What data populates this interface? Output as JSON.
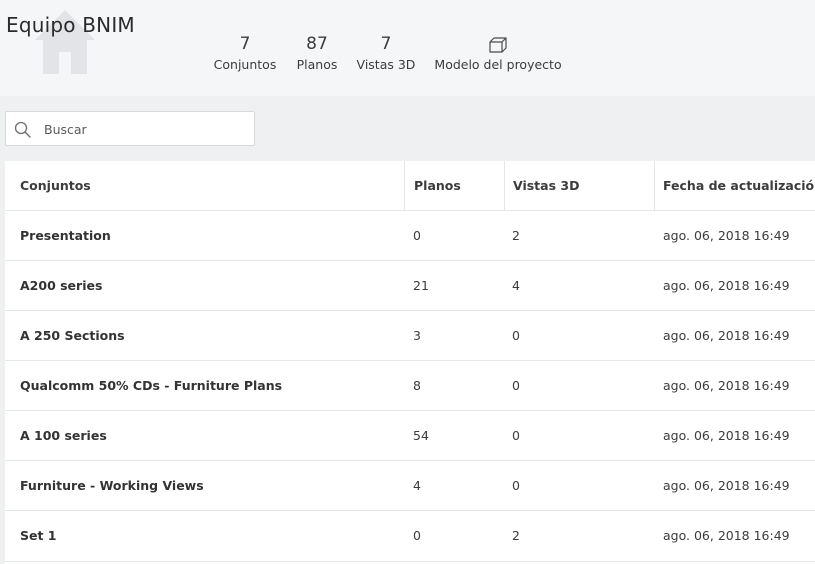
{
  "project": {
    "title": "Equipo BNIM"
  },
  "stats": {
    "sets": {
      "value": "7",
      "label": "Conjuntos"
    },
    "sheets": {
      "value": "87",
      "label": "Planos"
    },
    "views": {
      "value": "7",
      "label": "Vistas 3D"
    },
    "model": {
      "icon": "cube-icon",
      "label": "Modelo del proyecto"
    }
  },
  "search": {
    "placeholder": "Buscar",
    "value": ""
  },
  "table": {
    "headers": {
      "name": "Conjuntos",
      "sheets": "Planos",
      "views": "Vistas 3D",
      "date": "Fecha de actualización"
    },
    "rows": [
      {
        "name": "Presentation",
        "sheets": "0",
        "views": "2",
        "date": "ago. 06, 2018 16:49"
      },
      {
        "name": "A200 series",
        "sheets": "21",
        "views": "4",
        "date": "ago. 06, 2018 16:49"
      },
      {
        "name": "A 250 Sections",
        "sheets": "3",
        "views": "0",
        "date": "ago. 06, 2018 16:49"
      },
      {
        "name": "Qualcomm 50% CDs - Furniture Plans",
        "sheets": "8",
        "views": "0",
        "date": "ago. 06, 2018 16:49"
      },
      {
        "name": "A 100 series",
        "sheets": "54",
        "views": "0",
        "date": "ago. 06, 2018 16:49"
      },
      {
        "name": "Furniture - Working Views",
        "sheets": "4",
        "views": "0",
        "date": "ago. 06, 2018 16:49"
      },
      {
        "name": "Set 1",
        "sheets": "0",
        "views": "2",
        "date": "ago. 06, 2018 16:49"
      }
    ]
  },
  "colors": {
    "header_bg": "#f5f6f8",
    "page_bg": "#eef0f2",
    "house_icon": "#e2e4e7",
    "divider": "#e4e6e8"
  }
}
